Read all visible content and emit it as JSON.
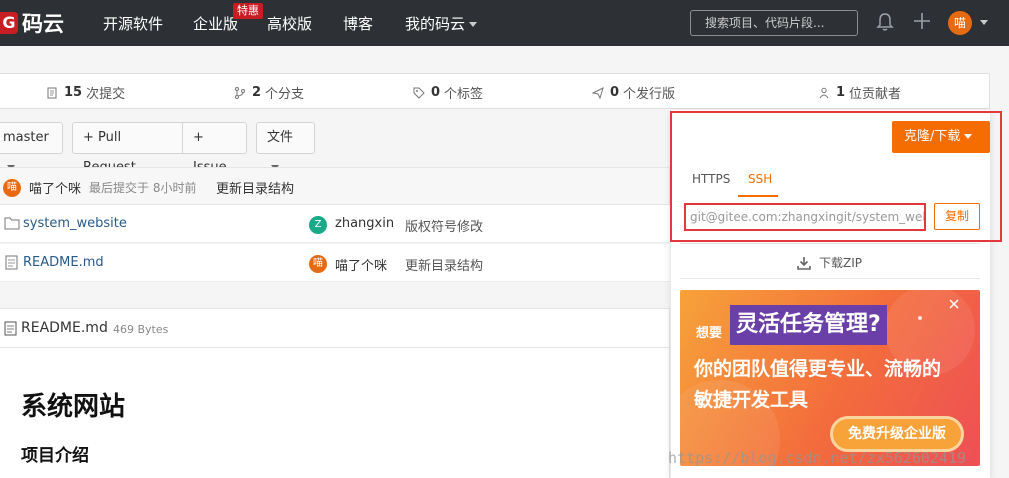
{
  "topbar": {
    "logo_mark": "G",
    "logo_text": "码云",
    "nav": [
      "开源软件",
      "企业版",
      "高校版",
      "博客",
      "我的码云"
    ],
    "hot_badge": "特惠",
    "search_placeholder": "搜索项目、代码片段...",
    "avatar_text": "喵"
  },
  "stats": [
    {
      "count": "15",
      "label": "次提交",
      "icon": "commit-icon"
    },
    {
      "count": "2",
      "label": "个分支",
      "icon": "branch-icon"
    },
    {
      "count": "0",
      "label": "个标签",
      "icon": "tag-icon"
    },
    {
      "count": "0",
      "label": "个发行版",
      "icon": "release-icon"
    },
    {
      "count": "1",
      "label": "位贡献者",
      "icon": "contributors-icon"
    }
  ],
  "toolbar": {
    "branch": "master",
    "pull_request": "+ Pull Request",
    "issue": "+ Issue",
    "file_menu": "文件"
  },
  "last_commit": {
    "avatar": "喵",
    "author": "喵了个咪",
    "meta": "最后提交于 8小时前",
    "message": "更新目录结构"
  },
  "files": [
    {
      "name": "system_website",
      "type": "folder",
      "author_avatar": "Z",
      "author": "zhangxin",
      "message": "版权符号修改",
      "avatar_color": "#1aaa8a"
    },
    {
      "name": "README.md",
      "type": "file",
      "author_avatar": "喵",
      "author": "喵了个咪",
      "message": "更新目录结构",
      "avatar_color": "#e86a10"
    }
  ],
  "readme": {
    "filename": "README.md",
    "size": "469 Bytes",
    "h1": "系统网站",
    "h3": "项目介绍"
  },
  "clone": {
    "button": "克隆/下载",
    "tabs": [
      "HTTPS",
      "SSH"
    ],
    "active_tab": "SSH",
    "url": "git@gitee.com:zhangxingit/system_website.git",
    "copy": "复制",
    "download": "下载ZIP"
  },
  "ad": {
    "small": "想要",
    "highlight": "灵活任务管理?",
    "line1": "你的团队值得更专业、流畅的",
    "line2": "敏捷开发工具",
    "cta": "免费升级企业版"
  },
  "watermark": "https://blog.csdn.net/zx562602419",
  "colors": {
    "accent": "#f56c00",
    "topbar": "#2d3135",
    "highlight_border": "#e4393c"
  }
}
